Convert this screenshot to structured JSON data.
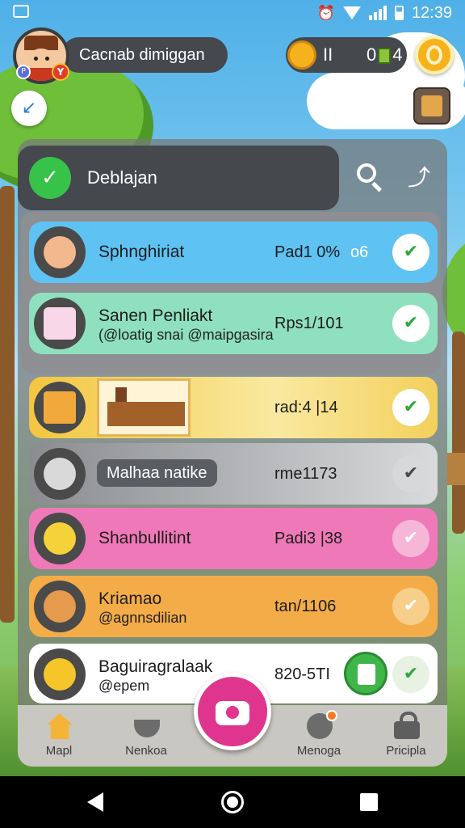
{
  "status_bar": {
    "time": "12:39"
  },
  "header": {
    "username": "Cacnab dimiggan",
    "avatar_badge": "Y",
    "avatar_badge2": "P",
    "coins": "II",
    "gems": "0",
    "gems_suffix": "4"
  },
  "panel": {
    "title": "Deblajan"
  },
  "rows": [
    {
      "name": "Sphnghiriat",
      "value": "Pad1 0%",
      "extra": "o6"
    },
    {
      "name": "Sanen Penliakt",
      "sub": "(@loatig snai @maipgasira",
      "value": "Rps1/101"
    },
    {
      "name": "",
      "value": "rad:4 |14"
    },
    {
      "name": "Malhaa natike",
      "value": "rme1173"
    },
    {
      "name": "Shanbullitint",
      "value": "Padi3 |38"
    },
    {
      "name": "Kriamao",
      "sub": "@agnnsdilian",
      "value": "tan/1106"
    },
    {
      "name": "Baguiragralaak",
      "sub": "@epem",
      "value": "820-5TI"
    }
  ],
  "bottom_nav": {
    "items": [
      {
        "label": "Mapl",
        "icon": "home-icon"
      },
      {
        "label": "Nenkoa",
        "icon": "bowl-icon"
      },
      {
        "label": "Menoga",
        "icon": "chat-icon"
      },
      {
        "label": "Pricipla",
        "icon": "lock-icon"
      }
    ],
    "fab_icon": "camera-icon"
  },
  "colors": {
    "accent_green": "#37c24a",
    "fab_pink": "#e0358e",
    "coin_gold": "#f6b21d",
    "panel_dark": "#45484d"
  }
}
